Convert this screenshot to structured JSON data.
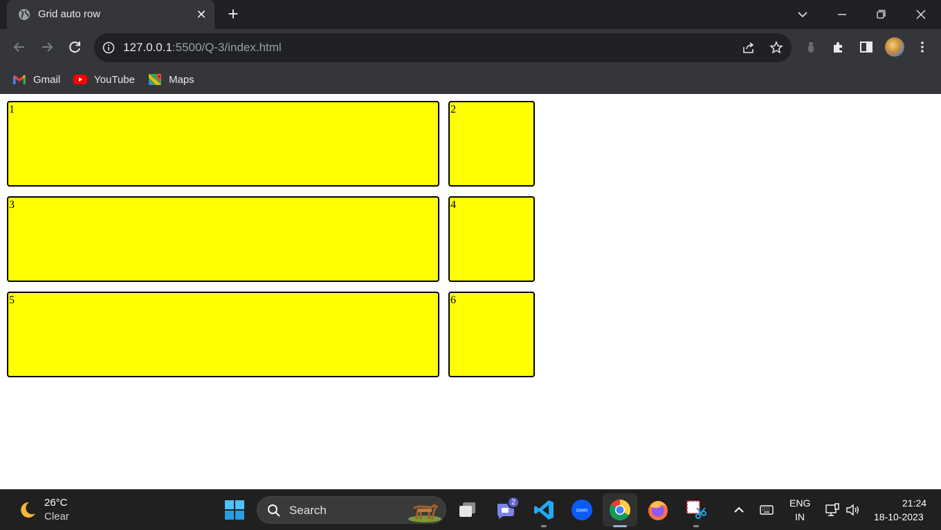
{
  "browser": {
    "tab": {
      "title": "Grid auto row",
      "close": "✕"
    },
    "new_tab": "+",
    "url_host": "127.0.0.1",
    "url_rest": ":5500/Q-3/index.html",
    "bookmarks": [
      {
        "label": "Gmail",
        "icon": "gmail-icon"
      },
      {
        "label": "YouTube",
        "icon": "youtube-icon"
      },
      {
        "label": "Maps",
        "icon": "maps-icon"
      }
    ]
  },
  "page": {
    "cells": [
      "1",
      "2",
      "3",
      "4",
      "5",
      "6"
    ],
    "cell_color": "#ffff00"
  },
  "taskbar": {
    "weather": {
      "temp": "26°C",
      "condition": "Clear"
    },
    "search_label": "Search",
    "chat_badge": "2",
    "lang": {
      "line1": "ENG",
      "line2": "IN"
    },
    "clock": {
      "time": "21:24",
      "date": "18-10-2023"
    }
  }
}
